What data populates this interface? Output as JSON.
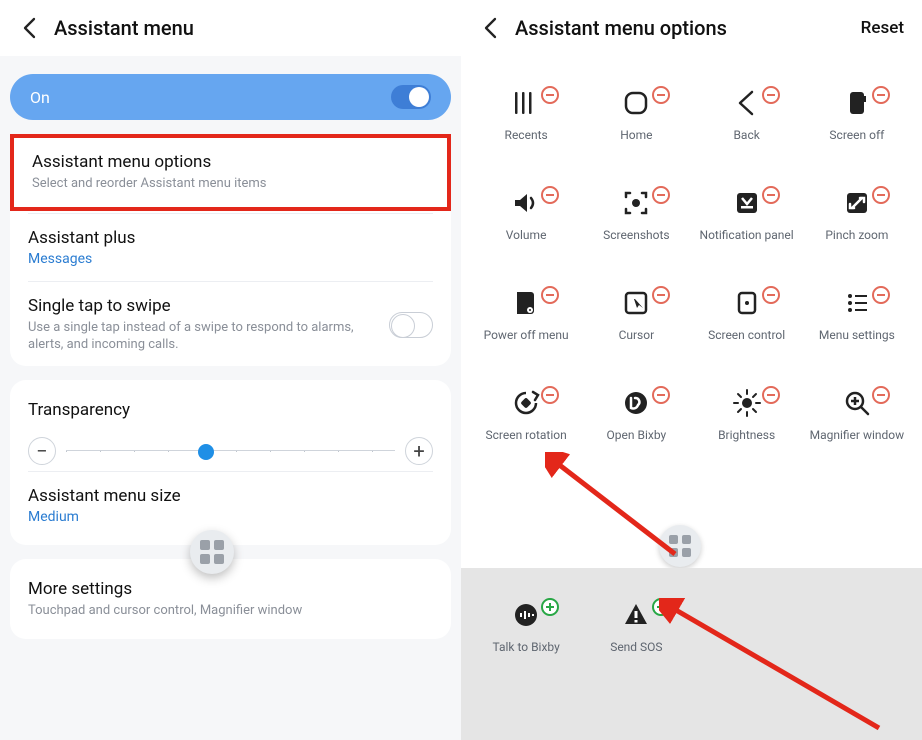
{
  "left": {
    "header_title": "Assistant menu",
    "toggle_label": "On",
    "rows": {
      "options": {
        "title": "Assistant menu options",
        "sub": "Select and reorder Assistant menu items"
      },
      "plus": {
        "title": "Assistant plus",
        "accent": "Messages"
      },
      "tap": {
        "title": "Single tap to swipe",
        "sub": "Use a single tap instead of a swipe to respond to alarms, alerts, and incoming calls."
      },
      "transparency": {
        "title": "Transparency"
      },
      "size": {
        "title": "Assistant menu size",
        "accent": "Medium"
      },
      "more": {
        "title": "More settings",
        "sub": "Touchpad and cursor control, Magnifier window"
      }
    },
    "minus": "−",
    "plus_sym": "+"
  },
  "right": {
    "header_title": "Assistant menu options",
    "reset": "Reset",
    "items": [
      {
        "label": "Recents",
        "icon": "recents",
        "badge": "minus"
      },
      {
        "label": "Home",
        "icon": "home",
        "badge": "minus"
      },
      {
        "label": "Back",
        "icon": "back",
        "badge": "minus"
      },
      {
        "label": "Screen off",
        "icon": "screenoff",
        "badge": "minus"
      },
      {
        "label": "Volume",
        "icon": "volume",
        "badge": "minus"
      },
      {
        "label": "Screenshots",
        "icon": "screenshot",
        "badge": "minus"
      },
      {
        "label": "Notification panel",
        "icon": "notif",
        "badge": "minus"
      },
      {
        "label": "Pinch zoom",
        "icon": "pinch",
        "badge": "minus"
      },
      {
        "label": "Power off menu",
        "icon": "power",
        "badge": "minus"
      },
      {
        "label": "Cursor",
        "icon": "cursor",
        "badge": "minus"
      },
      {
        "label": "Screen control",
        "icon": "screenctrl",
        "badge": "minus"
      },
      {
        "label": "Menu settings",
        "icon": "menuset",
        "badge": "minus"
      },
      {
        "label": "Screen rotation",
        "icon": "rotate",
        "badge": "minus"
      },
      {
        "label": "Open Bixby",
        "icon": "bixby",
        "badge": "minus"
      },
      {
        "label": "Brightness",
        "icon": "bright",
        "badge": "minus"
      },
      {
        "label": "Magnifier window",
        "icon": "mag",
        "badge": "minus"
      }
    ],
    "bottom_items": [
      {
        "label": "Talk to Bixby",
        "icon": "talkbixby",
        "badge": "plus"
      },
      {
        "label": "Send SOS",
        "icon": "sos",
        "badge": "plus"
      }
    ]
  }
}
